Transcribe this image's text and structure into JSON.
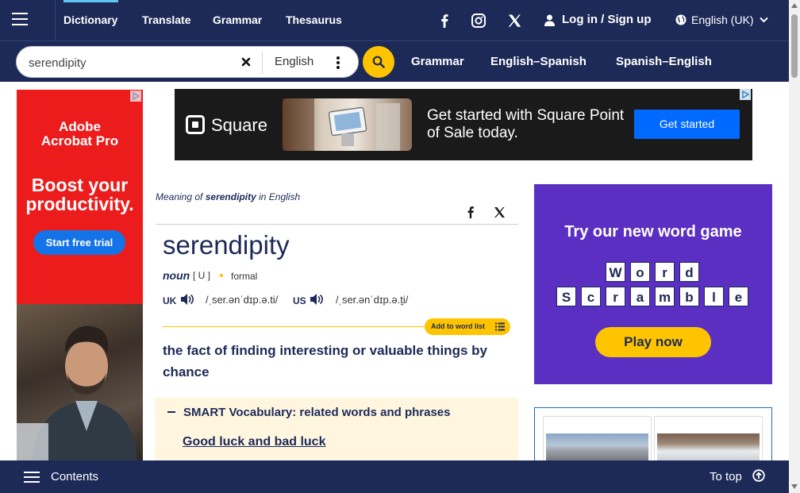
{
  "nav": {
    "links": [
      "Dictionary",
      "Translate",
      "Grammar",
      "Thesaurus"
    ],
    "login": "Log in / Sign up",
    "language": "English (UK)"
  },
  "search": {
    "value": "serendipity",
    "language": "English",
    "links": [
      "Grammar",
      "English–Spanish",
      "Spanish–English"
    ]
  },
  "ads": {
    "left": {
      "brand_line1": "Adobe",
      "brand_line2": "Acrobat Pro",
      "headline_line1": "Boost your",
      "headline_line2": "productivity.",
      "cta": "Start free trial"
    },
    "banner": {
      "brand": "Square",
      "headline": "Get started with Square Point of Sale today.",
      "cta": "Get started"
    },
    "game": {
      "title": "Try our new word game",
      "row1": [
        "W",
        "o",
        "r",
        "d"
      ],
      "row2": [
        "S",
        "c",
        "r",
        "a",
        "m",
        "b",
        "l",
        "e"
      ],
      "cta": "Play now"
    }
  },
  "entry": {
    "meaning_prefix": "Meaning of",
    "meaning_word": "serendipity",
    "meaning_suffix": "in English",
    "headword": "serendipity",
    "pos": "noun",
    "grammar": "[ U ]",
    "usage": "formal",
    "uk_label": "UK",
    "uk_ipa": "/ˌser.ənˈdɪp.ə.ti/",
    "us_label": "US",
    "us_ipa": "/ˌser.ənˈdɪp.ə.t̬i/",
    "add_to_word_list": "Add to word list",
    "definition": "the fact of finding interesting or valuable things by chance",
    "smart_vocab_title": "SMART Vocabulary: related words and phrases",
    "smart_vocab_link": "Good luck and bad luck"
  },
  "bottom": {
    "contents": "Contents",
    "to_top": "To top"
  },
  "colors": {
    "navy": "#1d2a57",
    "yellow": "#fec400",
    "adobe_red": "#ec1c1c",
    "game_purple": "#5a2fc2",
    "square_blue": "#006aff"
  }
}
